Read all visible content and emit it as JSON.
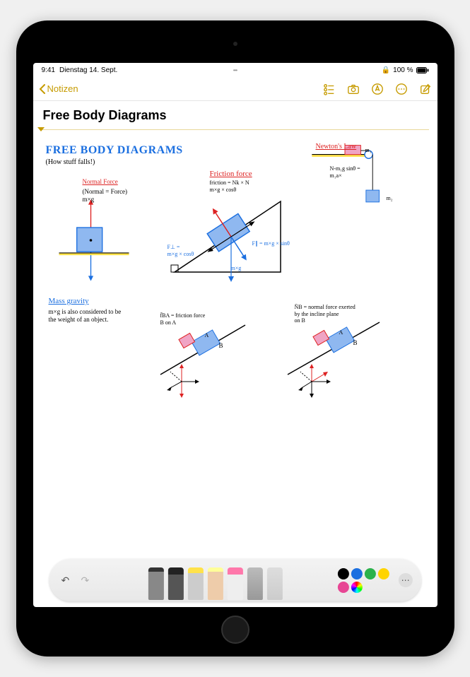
{
  "status": {
    "time": "9:41",
    "date": "Dienstag 14. Sept.",
    "battery": "100 %",
    "battery_icon": "battery-full"
  },
  "nav": {
    "back_label": "Notizen",
    "icons": [
      "checklist",
      "camera",
      "markup",
      "more",
      "compose"
    ]
  },
  "note": {
    "title": "Free Body Diagrams"
  },
  "sketch": {
    "title": "FREE BODY DIAGRAMS",
    "subtitle": "(How stuff falls!)",
    "normal_force_label": "Normal Force",
    "normal_eq": "(Normal = Force)\nm×g",
    "mass_gravity_label": "Mass gravity",
    "mass_gravity_text": "m×g is also considered to be the weight of an object.",
    "friction_label": "Friction force",
    "friction_eq": "friction = Nk × N\nm×g × cosθ",
    "f_perp": "F⊥ =\nm×g × cosθ",
    "f_par": "F∥ = m×g × sinθ",
    "mxg": "m×g",
    "newton_label": "Newton's Law",
    "newton_m1": "m₁",
    "newton_m2": "m₂",
    "newton_eq": "N-m₁g sinθ =\nm₁a×",
    "fba_text": "f̄BA = friction force\nB on A",
    "nb_text": "N̄B = normal force exerted\nby the incline plane\non B",
    "label_A": "A",
    "label_B": "B"
  },
  "toolbar": {
    "undo": "undo",
    "redo": "redo",
    "tools": [
      "pencil",
      "pen",
      "marker",
      "pencil2",
      "eraser",
      "lasso",
      "ruler"
    ],
    "colors": [
      "#000000",
      "#1b6fe0",
      "#2bb24c",
      "#ffd400",
      "#e74694",
      "#multicolor"
    ],
    "more": "more"
  }
}
